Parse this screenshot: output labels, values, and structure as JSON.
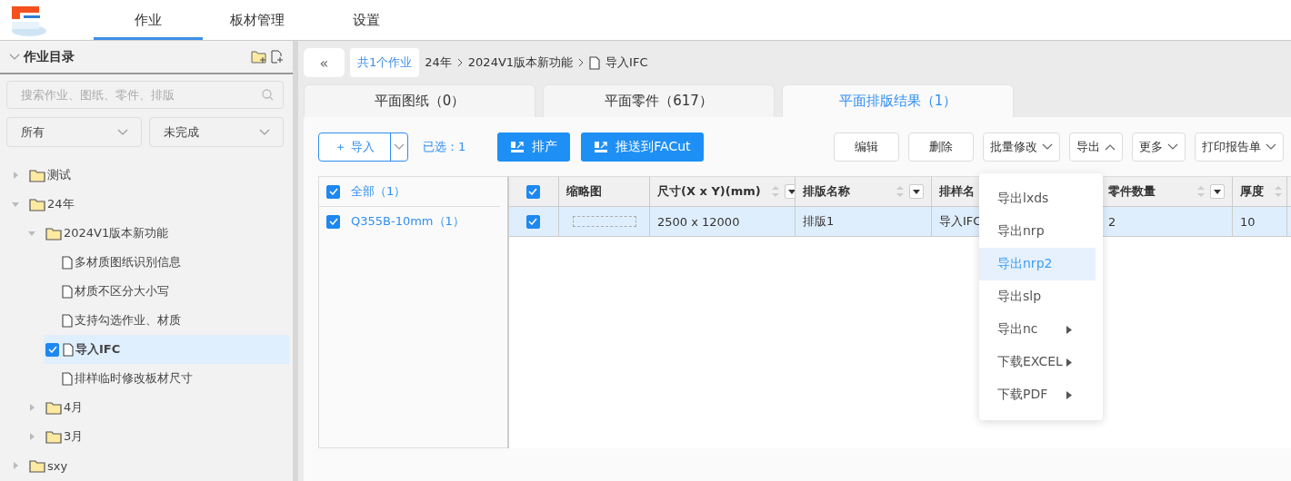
{
  "nav": {
    "items": [
      {
        "label": "作业",
        "selected": true
      },
      {
        "label": "板材管理",
        "selected": false
      },
      {
        "label": "设置",
        "selected": false
      }
    ]
  },
  "sidebar": {
    "title": "作业目录",
    "search": {
      "placeholder": "搜索作业、图纸、零件、排版"
    },
    "filters": [
      {
        "value": "所有"
      },
      {
        "value": "未完成"
      }
    ],
    "tree": [
      {
        "kind": "folder",
        "label": "测试",
        "expanded": false,
        "selected": false
      },
      {
        "kind": "folder",
        "label": "24年",
        "expanded": true,
        "selected": false,
        "children": [
          {
            "kind": "folder",
            "label": "2024V1版本新功能",
            "expanded": true,
            "selected": false,
            "children": [
              {
                "kind": "file",
                "label": "多材质图纸识别信息",
                "selected": false
              },
              {
                "kind": "file",
                "label": "材质不区分大小写",
                "selected": false
              },
              {
                "kind": "file",
                "label": "支持勾选作业、材质",
                "selected": false
              },
              {
                "kind": "file",
                "label": "导入IFC",
                "selected": true
              },
              {
                "kind": "file",
                "label": "排样临时修改板材尺寸",
                "selected": false
              }
            ]
          },
          {
            "kind": "folder",
            "label": "4月",
            "expanded": false,
            "selected": false
          },
          {
            "kind": "folder",
            "label": "3月",
            "expanded": false,
            "selected": false
          }
        ]
      },
      {
        "kind": "folder",
        "label": "sxy",
        "expanded": false,
        "selected": false
      }
    ]
  },
  "breadcrumb": {
    "back": "«",
    "count": "共1个作业",
    "path": [
      "24年",
      "2024V1版本新功能"
    ],
    "current": "导入IFC"
  },
  "tabs": [
    {
      "label": "平面图纸（0）",
      "selected": false
    },
    {
      "label": "平面零件（617）",
      "selected": false
    },
    {
      "label": "平面排版结果（1）",
      "selected": true
    }
  ],
  "toolbar": {
    "import": "＋ 导入",
    "selected_count": "已选：1",
    "primary": [
      {
        "label": "排产"
      },
      {
        "label": "推送到FACut"
      }
    ],
    "buttons": [
      {
        "label": "编辑",
        "kind": "plain"
      },
      {
        "label": "删除",
        "kind": "plain"
      },
      {
        "label": "批量修改",
        "kind": "dropdown",
        "open": false
      },
      {
        "label": "导出",
        "kind": "dropdown",
        "open": true
      },
      {
        "label": "更多",
        "kind": "dropdown",
        "open": false
      },
      {
        "label": "打印报告单",
        "kind": "dropdown",
        "open": false
      }
    ]
  },
  "materials": [
    {
      "label": "全部（1）",
      "checked": true
    },
    {
      "label": "Q355B-10mm（1）",
      "checked": true
    }
  ],
  "table": {
    "all_checked": true,
    "columns": [
      {
        "label": "缩略图",
        "sort": false,
        "filter": false
      },
      {
        "label": "尺寸(X x Y)(mm)",
        "sort": true,
        "filter": true
      },
      {
        "label": "排版名称",
        "sort": true,
        "filter": true
      },
      {
        "label": "排样名"
      },
      {
        "label": "零件数量",
        "sort": true,
        "filter": true
      },
      {
        "label": "厚度",
        "sort": true,
        "filter": false
      }
    ],
    "rows": [
      {
        "checked": true,
        "selected": true,
        "cells": [
          "",
          "2500 x 12000",
          "排版1",
          "导入IFC",
          "2",
          "10"
        ]
      }
    ]
  },
  "export_menu": [
    {
      "label": "导出lxds",
      "submenu": false,
      "selected": false
    },
    {
      "label": "导出nrp",
      "submenu": false,
      "selected": false
    },
    {
      "label": "导出nrp2",
      "submenu": false,
      "selected": true
    },
    {
      "label": "导出slp",
      "submenu": false,
      "selected": false
    },
    {
      "label": "导出nc",
      "submenu": true,
      "selected": false
    },
    {
      "label": "下载EXCEL",
      "submenu": true,
      "selected": false
    },
    {
      "label": "下载PDF",
      "submenu": true,
      "selected": false
    }
  ]
}
